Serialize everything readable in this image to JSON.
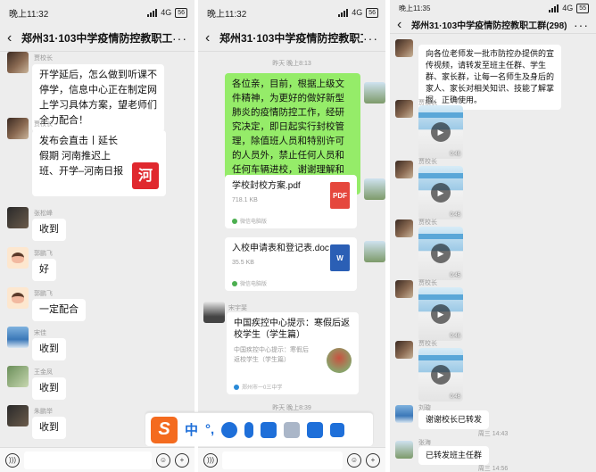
{
  "panel1": {
    "status_time": "晚上11:32",
    "network": "4G",
    "battery": "56",
    "title": "郑州31·103中学疫情防控教职工群(298)",
    "messages": [
      {
        "sender": "贾校长",
        "text": "开学延后，怎么做到听课不停学，信息中心正在制定网上学习具体方案，望老师们全力配合！"
      },
      {
        "sender": "贾校长",
        "text": "发布会直击丨延长假期 河南推迟上班、开学–河南日报",
        "link_icon": "河"
      },
      {
        "sender": "张松峰",
        "text": "收到"
      },
      {
        "sender": "郭鹏飞",
        "text": "好"
      },
      {
        "sender": "郭鹏飞",
        "text": "一定配合"
      },
      {
        "sender": "宋佳",
        "text": "收到"
      },
      {
        "sender": "王金凤",
        "text": "收到"
      },
      {
        "sender": "朱鹏举",
        "text": "收到"
      }
    ]
  },
  "panel2": {
    "status_time": "晚上11:32",
    "network": "4G",
    "battery": "56",
    "title": "郑州31·103中学疫情防控教职工群(298)",
    "time_top": "昨天 晚上8:13",
    "green_text": "各位亲，目前，根据上级文件精神，为更好的做好新型肺炎的疫情防控工作，经研究决定，即日起实行封校管理，除值班人员和特别许可的人员外，禁止任何人员和任何车辆进校，谢谢理解和配合。",
    "file1": {
      "name": "学校封校方案.pdf",
      "size": "718.1 KB",
      "source": "微信电脑版",
      "badge": "PDF"
    },
    "file2": {
      "name": "入校申请表和登记表.doc",
      "size": "35.5 KB",
      "source": "微信电脑版",
      "badge": "W"
    },
    "sender3": "宋宇斐",
    "article": {
      "title": "中国疾控中心提示：寒假后返校学生（学生篇）",
      "desc": "中国疾控中心提示：寒假后返校学生（学生篇）",
      "source": "郑州市一0三中学"
    },
    "time_bottom": "昨天 晚上8:39"
  },
  "panel3": {
    "status_time": "晚上11:35",
    "network": "4G",
    "battery": "55",
    "title": "郑州31·103中学疫情防控教职工群(298)",
    "top_text": "向各位老师发一批市防控办提供的宣传视频，请转发至班主任群、学生群、家长群，让每一名师生及身后的家人、家长对相关知识、技能了解掌握、正确使用。",
    "video_sender": "贾校长",
    "videos": [
      {
        "duration": "0:46"
      },
      {
        "duration": "0:46"
      },
      {
        "duration": "0:45"
      },
      {
        "duration": "0:46"
      },
      {
        "duration": "0:46"
      }
    ],
    "reply1": {
      "sender": "刘璇",
      "text": "谢谢校长已转发"
    },
    "time1": "周三 14:43",
    "reply2": {
      "sender": "张海",
      "text": "已转发班主任群"
    },
    "time2": "周三 14:56"
  },
  "ime": {
    "logo": "S",
    "lang": "中",
    "punct": "°,"
  }
}
